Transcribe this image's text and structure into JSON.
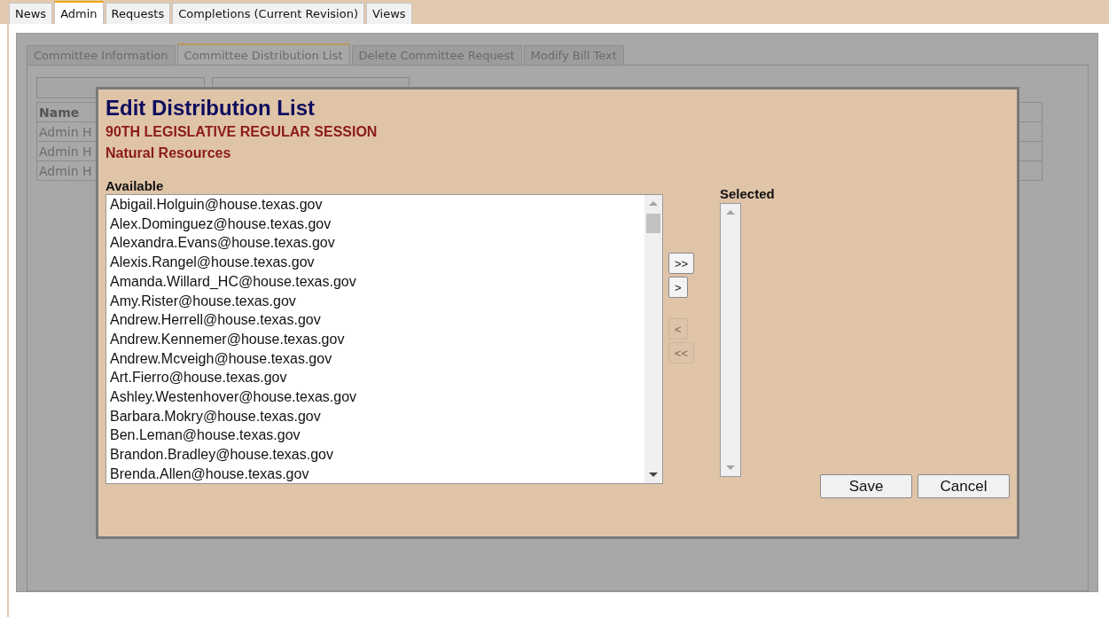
{
  "main_tabs": [
    {
      "label": "News",
      "selected": false
    },
    {
      "label": "Admin",
      "selected": true
    },
    {
      "label": "Requests",
      "selected": false
    },
    {
      "label": "Completions (Current Revision)",
      "selected": false
    },
    {
      "label": "Views",
      "selected": false
    }
  ],
  "sub_tabs": [
    {
      "label": "Committee Information",
      "selected": false
    },
    {
      "label": "Committee Distribution List",
      "selected": true
    },
    {
      "label": "Delete Committee Request",
      "selected": false
    },
    {
      "label": "Modify Bill Text",
      "selected": false
    }
  ],
  "table": {
    "columns": [
      "Name"
    ],
    "rows": [
      "Admin H",
      "Admin H",
      "Admin H"
    ]
  },
  "dialog": {
    "title": "Edit Distribution List",
    "session": "90TH LEGISLATIVE REGULAR SESSION",
    "committee": "Natural Resources",
    "available": {
      "label": "Available",
      "items": [
        "Abigail.Holguin@house.texas.gov",
        "Alex.Dominguez@house.texas.gov",
        "Alexandra.Evans@house.texas.gov",
        "Alexis.Rangel@house.texas.gov",
        "Amanda.Willard_HC@house.texas.gov",
        "Amy.Rister@house.texas.gov",
        "Andrew.Herrell@house.texas.gov",
        "Andrew.Kennemer@house.texas.gov",
        "Andrew.Mcveigh@house.texas.gov",
        "Art.Fierro@house.texas.gov",
        "Ashley.Westenhover@house.texas.gov",
        "Barbara.Mokry@house.texas.gov",
        "Ben.Leman@house.texas.gov",
        "Brandon.Bradley@house.texas.gov",
        "Brenda.Allen@house.texas.gov"
      ]
    },
    "transfer_buttons": [
      {
        "label": ">>",
        "disabled": false
      },
      {
        "label": ">",
        "disabled": false
      },
      {
        "label": "<",
        "disabled": true
      },
      {
        "label": "<<",
        "disabled": true
      }
    ],
    "selected": {
      "label": "Selected"
    },
    "buttons": [
      "Save",
      "Cancel"
    ]
  }
}
